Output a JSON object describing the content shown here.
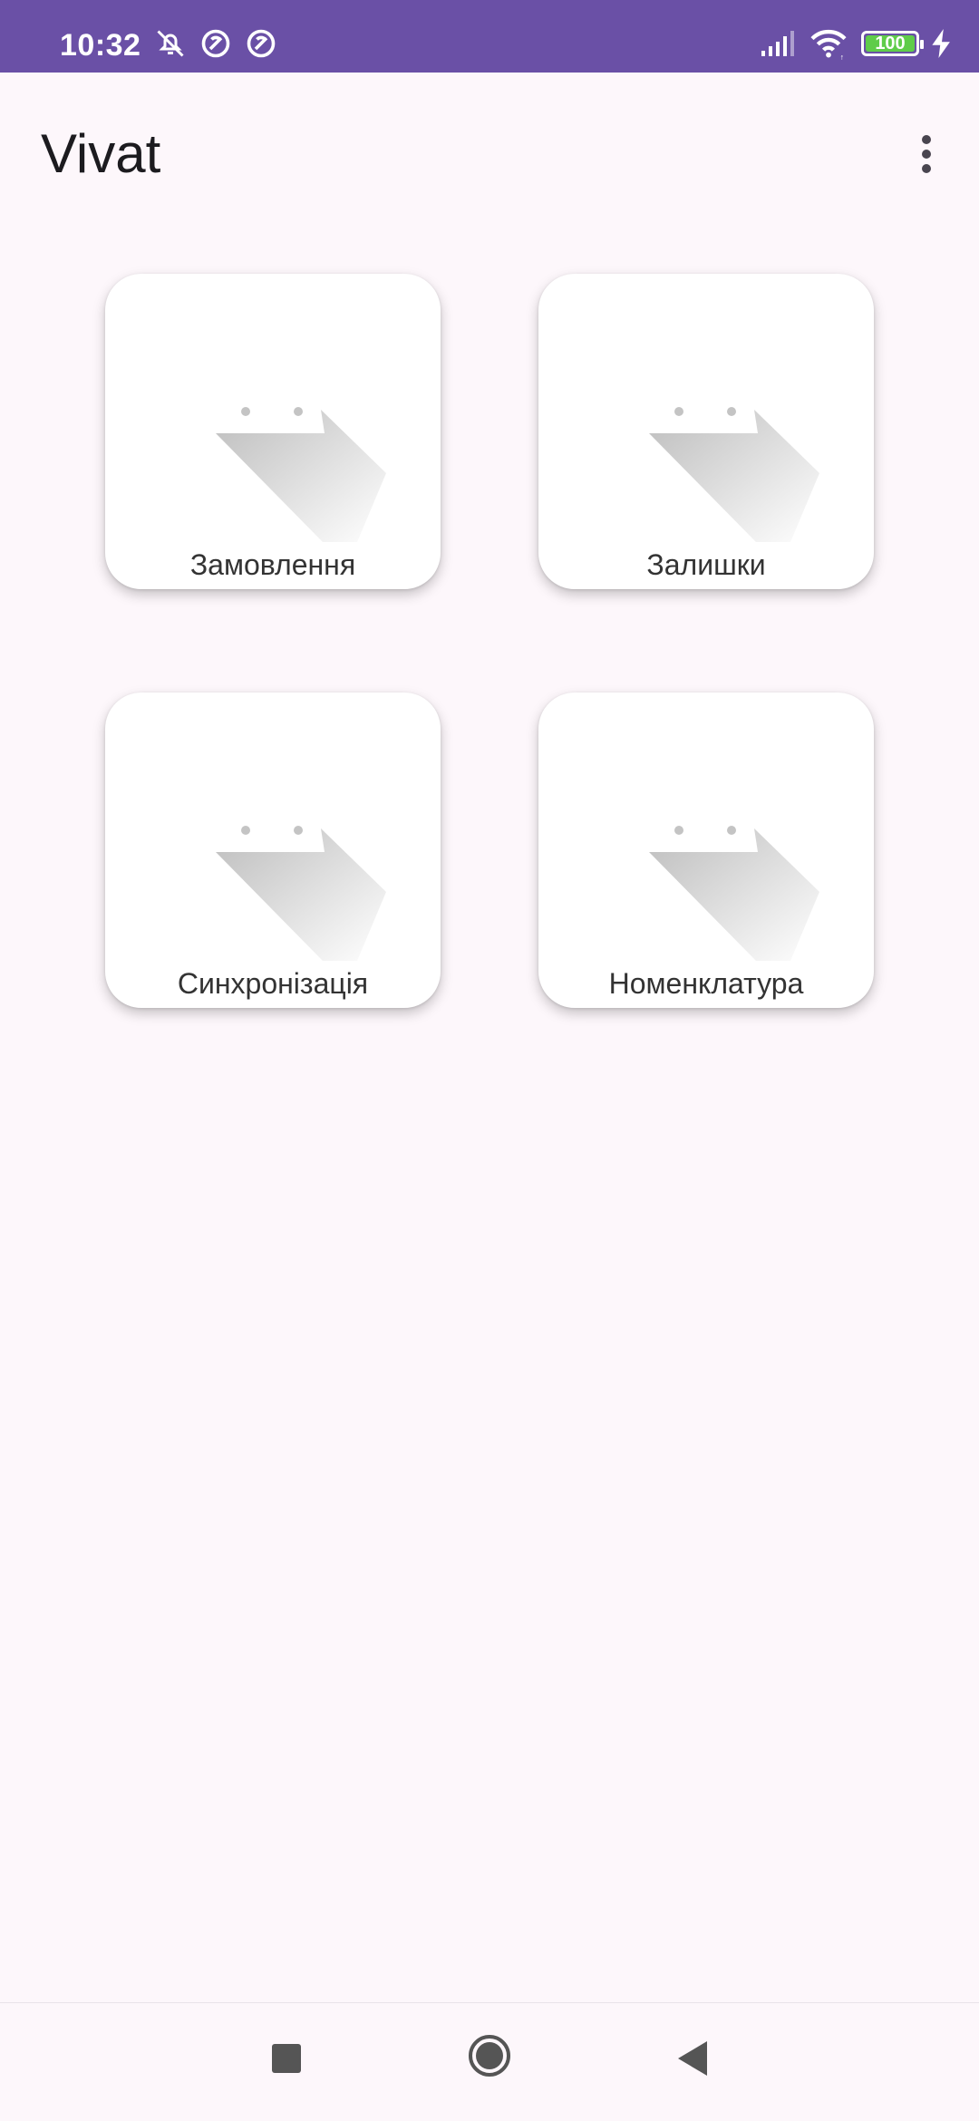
{
  "status_bar": {
    "time": "10:32",
    "icons_left": [
      "mute-alarm-icon",
      "sync-disabled-icon",
      "sync-disabled-icon"
    ],
    "icons_right": [
      "signal-icon",
      "wifi-icon",
      "battery-icon",
      "charging-icon"
    ],
    "battery_level": "100",
    "background_color": "#6a50a6"
  },
  "app_bar": {
    "title": "Vivat",
    "menu_icon": "more-vert-icon"
  },
  "tiles": [
    {
      "label": "Замовлення",
      "icon": "image-placeholder-icon"
    },
    {
      "label": "Залишки",
      "icon": "image-placeholder-icon"
    },
    {
      "label": "Синхронізація",
      "icon": "image-placeholder-icon"
    },
    {
      "label": "Номенклатура",
      "icon": "image-placeholder-icon"
    }
  ],
  "nav_bar": {
    "buttons": [
      "recents-icon",
      "home-icon",
      "back-icon"
    ]
  }
}
